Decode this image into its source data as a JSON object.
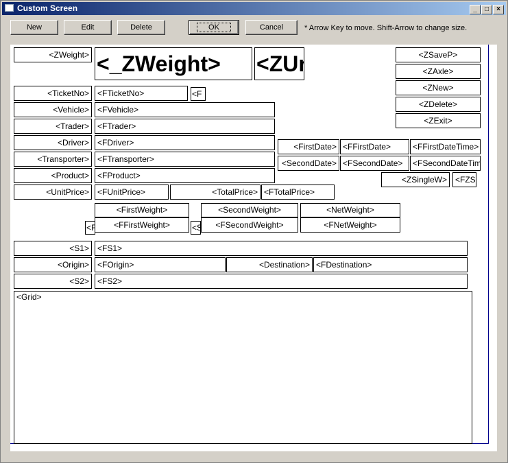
{
  "window": {
    "title": "Custom Screen"
  },
  "toolbar": {
    "new": "New",
    "edit": "Edit",
    "delete": "Delete",
    "ok": "OK",
    "cancel": "Cancel",
    "hint": "* Arrow Key to move. Shift-Arrow to change size."
  },
  "fields": {
    "zweight_label": "<ZWeight>",
    "zweight_big": "<_ZWeight>",
    "zunit_big": "<ZUnit>",
    "zsavep": "<ZSaveP>",
    "zaxle": "<ZAxle>",
    "znew": "<ZNew>",
    "zdelete": "<ZDelete>",
    "zexit": "<ZExit>",
    "ticketno": "<TicketNo>",
    "fticketno": "<FTicketNo>",
    "f_small": "<F",
    "vehicle": "<Vehicle>",
    "fvehicle": "<FVehicle>",
    "trader": "<Trader>",
    "ftrader": "<FTrader>",
    "driver": "<Driver>",
    "fdriver": "<FDriver>",
    "transporter": "<Transporter>",
    "ftransporter": "<FTransporter>",
    "product": "<Product>",
    "fproduct": "<FProduct>",
    "unitprice": "<UnitPrice>",
    "funitprice": "<FUnitPrice>",
    "totalprice": "<TotalPrice>",
    "ftotalprice": "<FTotalPrice>",
    "firstdate": "<FirstDate>",
    "ffirstdate": "<FFirstDate>",
    "ffirstdatetime": "<FFirstDateTime>",
    "seconddate": "<SecondDate>",
    "fseconddate": "<FSecondDate>",
    "fseconddatetime": "<FSecondDateTime>",
    "zsinglew": "<ZSingleW>",
    "fzs": "<FZS",
    "firstweight": "<FirstWeight>",
    "ffirstweight": "<FFirstWeight>",
    "secondweight": "<SecondWeight>",
    "fsecondweight": "<FSecondWeight>",
    "netweight": "<NetWeight>",
    "fnetweight": "<FNetWeight>",
    "tiny_f": "<F",
    "tiny_s": "<S",
    "s1": "<S1>",
    "fs1": "<FS1>",
    "origin": "<Origin>",
    "forigin": "<FOrigin>",
    "destination": "<Destination>",
    "fdestination": "<FDestination>",
    "s2": "<S2>",
    "fs2": "<FS2>",
    "grid": "<Grid>"
  }
}
